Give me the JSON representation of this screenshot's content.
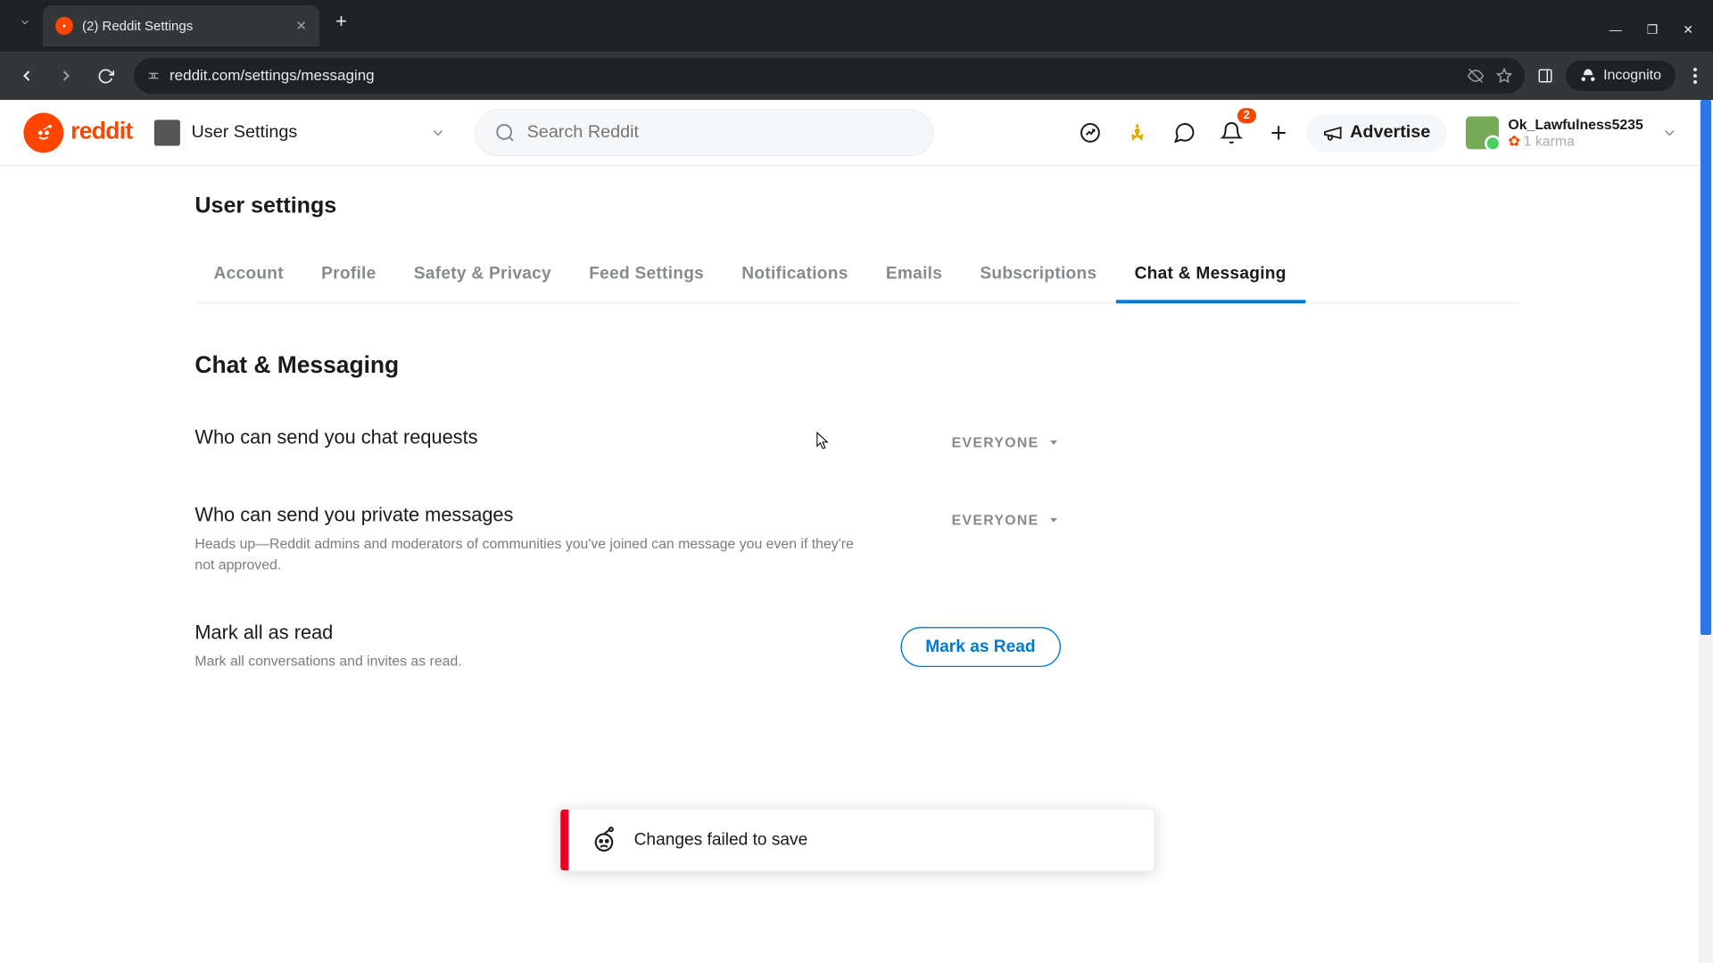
{
  "browser": {
    "tab_title": "(2) Reddit Settings",
    "url": "reddit.com/settings/messaging",
    "incognito_label": "Incognito"
  },
  "header": {
    "logo_text": "reddit",
    "nav_label": "User Settings",
    "search_placeholder": "Search Reddit",
    "advertise_label": "Advertise",
    "notification_count": "2",
    "username": "Ok_Lawfulness5235",
    "karma": "1 karma"
  },
  "settings": {
    "page_title": "User settings",
    "tabs": [
      "Account",
      "Profile",
      "Safety & Privacy",
      "Feed Settings",
      "Notifications",
      "Emails",
      "Subscriptions",
      "Chat & Messaging"
    ],
    "active_tab_index": 7,
    "section_title": "Chat & Messaging",
    "rows": {
      "chat_requests": {
        "label": "Who can send you chat requests",
        "value": "EVERYONE"
      },
      "private_messages": {
        "label": "Who can send you private messages",
        "desc": "Heads up—Reddit admins and moderators of communities you've joined can message you even if they're not approved.",
        "value": "EVERYONE"
      },
      "mark_read": {
        "label": "Mark all as read",
        "desc": "Mark all conversations and invites as read.",
        "button": "Mark as Read"
      }
    }
  },
  "toast": {
    "message": "Changes failed to save"
  }
}
